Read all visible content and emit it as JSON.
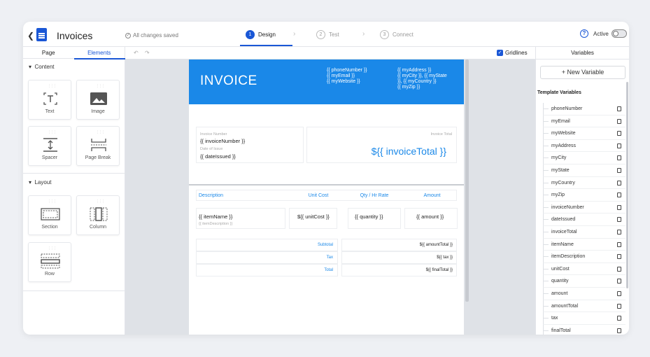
{
  "app": {
    "title": "Invoices",
    "saved_status": "All changes saved"
  },
  "steps": [
    {
      "num": "1",
      "label": "Design"
    },
    {
      "num": "2",
      "label": "Test"
    },
    {
      "num": "3",
      "label": "Connect"
    }
  ],
  "header_right": {
    "active_label": "Active",
    "active_on": false
  },
  "left_panel": {
    "tabs": [
      "Page",
      "Elements"
    ],
    "content_heading": "Content",
    "layout_heading": "Layout",
    "content_items": [
      "Text",
      "Image",
      "Spacer",
      "Page Break"
    ],
    "layout_items": [
      "Section",
      "Column",
      "Row"
    ]
  },
  "toolbar": {
    "gridlines_label": "Gridlines",
    "gridlines_checked": true
  },
  "invoice": {
    "title": "INVOICE",
    "header_col1": "{{ phoneNumber }}\n{{ myEmail }}\n{{ myWebsite }}",
    "header_col2": "{{ myAddress }}\n{{ myCity }}, {{ myState\n}}, {{ myCountry }}\n{{ myZip }}",
    "invoice_number_label": "Invoice Number",
    "invoice_number_value": "{{ invoiceNumber }}",
    "date_label": "Date of Issue",
    "date_value": "{{ dateIssued }}",
    "invoice_total_label": "Invoice Total",
    "invoice_total_value": "${{ invoiceTotal }}",
    "columns": [
      "Description",
      "Unit Cost",
      "Qty / Hr Rate",
      "Amount"
    ],
    "row": {
      "item_name": "{{ itemName }}",
      "item_desc": "{{ itemDescription }}",
      "unit_cost": "${{ unitCost }}",
      "quantity": "{{ quantity }}",
      "amount": "{{ amount }}"
    },
    "summary": [
      {
        "label": "Subtotal",
        "value": "${{ amountTotal }}"
      },
      {
        "label": "Tax",
        "value": "${{ tax }}"
      },
      {
        "label": "Total",
        "value": "${{ finalTotal }}"
      }
    ]
  },
  "right_panel": {
    "heading": "Variables",
    "new_variable": "+ New Variable",
    "template_variables_title": "Template Variables",
    "variables": [
      "phoneNumber",
      "myEmail",
      "myWebsite",
      "myAddress",
      "myCity",
      "myState",
      "myCountry",
      "myZip",
      "invoiceNumber",
      "dateIssued",
      "invoiceTotal",
      "itemName",
      "itemDescription",
      "unitCost",
      "quantity",
      "amount",
      "amountTotal",
      "tax",
      "finalTotal"
    ]
  }
}
